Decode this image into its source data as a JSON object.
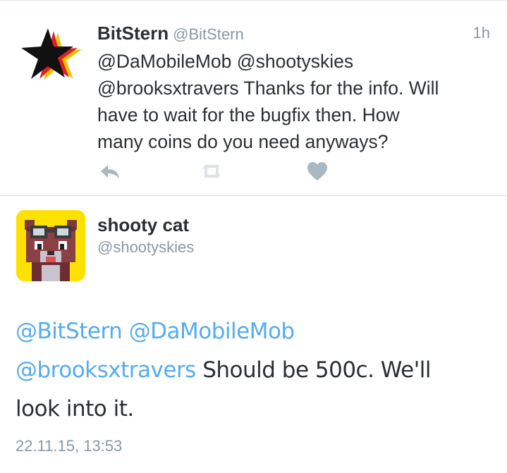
{
  "tweet1": {
    "name": "BitStern",
    "handle": "@BitStern",
    "time": "1h",
    "lines": [
      "@DaMobileMob @shootyskies",
      "@brooksxtravers Thanks for the info. Will",
      "have to wait for the bugfix then. How",
      "many coins do you need anyways?"
    ],
    "actions": [
      {
        "icon": "reply-icon"
      },
      {
        "icon": "retweet-icon"
      },
      {
        "icon": "heart-icon"
      }
    ]
  },
  "tweet2": {
    "name": "shooty cat",
    "handle": "@shootyskies",
    "mention1": "@BitStern",
    "mention2": "@DaMobileMob",
    "mention3": "@brooksxtravers",
    "text1": " Should be 500c. We'll",
    "text2": "look into it.",
    "date": "22.11.15, 13:53"
  },
  "colors": {
    "link": "#55acee",
    "meta": "#8899a6",
    "text": "#292f33",
    "action": "#aab8c2",
    "avatar_bg": "#ffe100"
  }
}
